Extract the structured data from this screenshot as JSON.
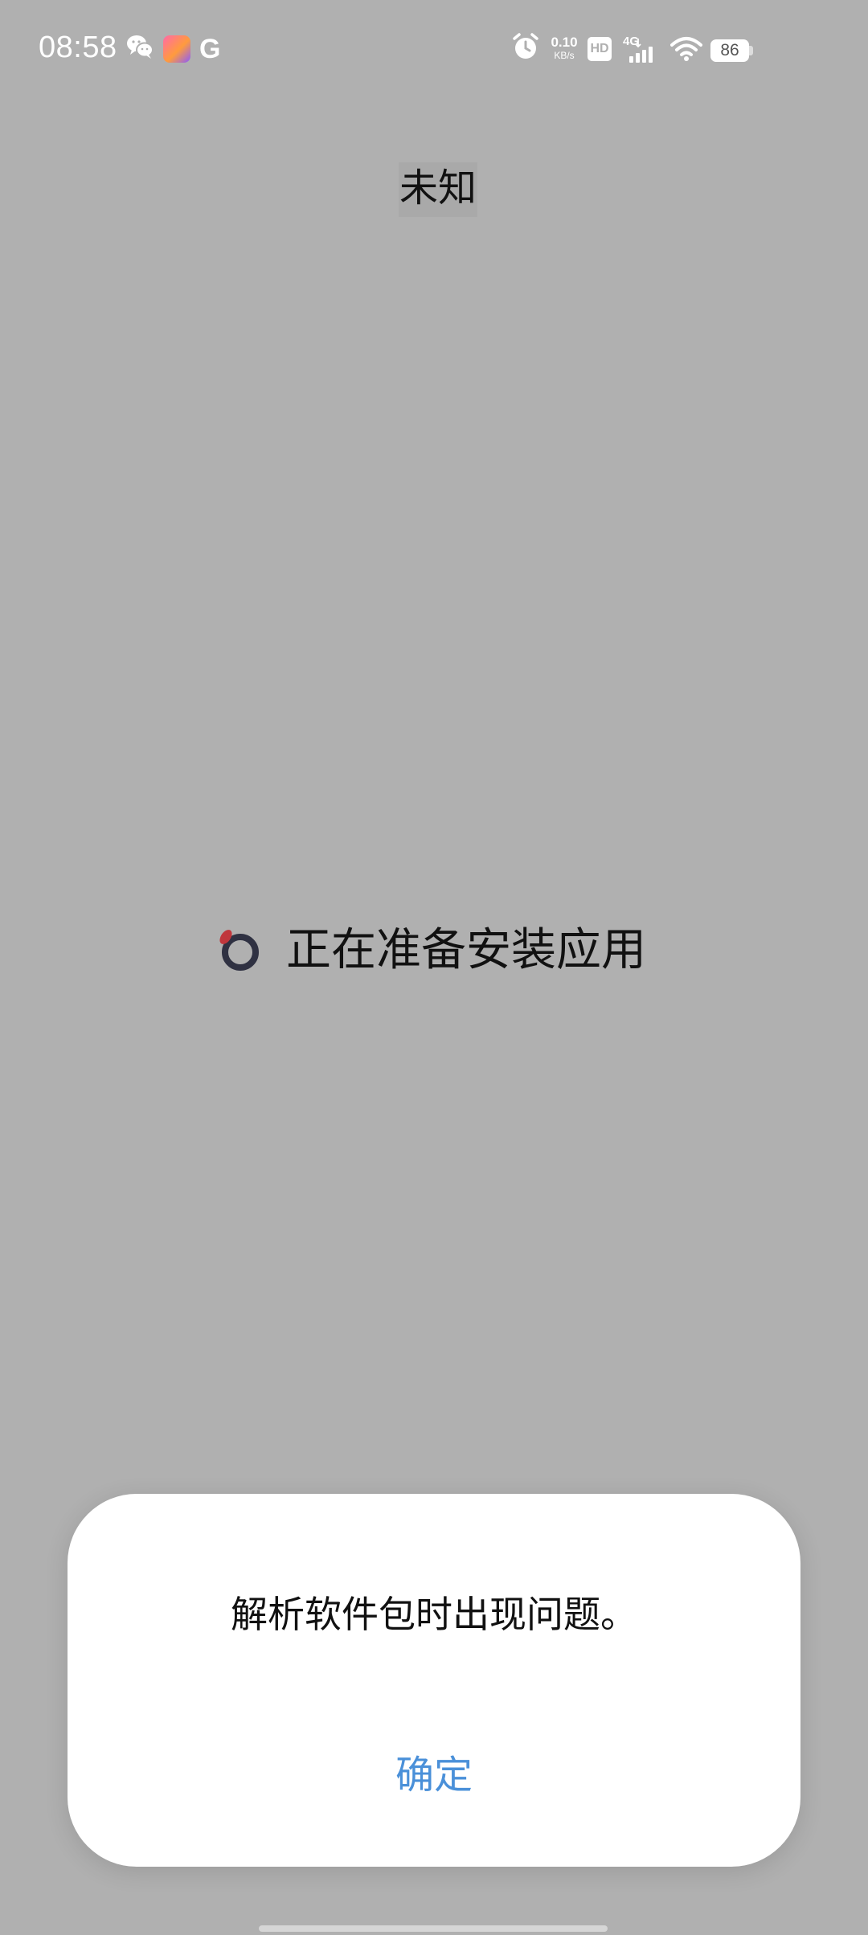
{
  "status_bar": {
    "time": "08:58",
    "network_speed_value": "0.10",
    "network_speed_unit": "KB/s",
    "hd_label": "HD",
    "network_type": "4G",
    "battery_level": "86",
    "icons": [
      "wechat-icon",
      "app-notification-icon",
      "google-icon",
      "alarm-icon",
      "hd-icon",
      "signal-icon",
      "wifi-icon",
      "battery-icon"
    ]
  },
  "installer": {
    "app_title": "未知",
    "progress_text": "正在准备安装应用"
  },
  "dialog": {
    "message": "解析软件包时出现问题。",
    "confirm_label": "确定"
  },
  "colors": {
    "background": "#b0b0b0",
    "dialog_background": "#ffffff",
    "accent": "#4a90d9",
    "spinner_ring": "#2f3142",
    "spinner_accent": "#c0363c"
  }
}
